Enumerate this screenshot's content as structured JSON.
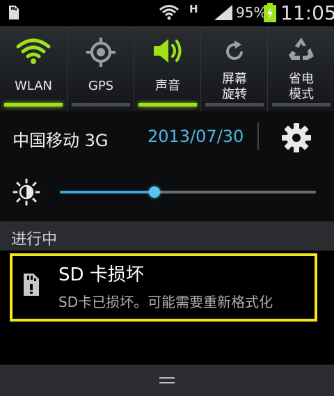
{
  "status_bar": {
    "network_type": "H",
    "battery_percent": "95%",
    "time": "11:05"
  },
  "quick_toggles": [
    {
      "label": "WLAN",
      "state": "on"
    },
    {
      "label": "GPS",
      "state": "off"
    },
    {
      "label": "声音",
      "state": "on"
    },
    {
      "label": "屏幕\n旋转",
      "state": "off"
    },
    {
      "label": "省电\n模式",
      "state": "off"
    }
  ],
  "info_row": {
    "carrier": "中国移动 3G",
    "date": "2013/07/30"
  },
  "brightness": {
    "level": 0.37
  },
  "section": {
    "title": "进行中"
  },
  "notification": {
    "title": "SD 卡损坏",
    "text": "SD卡已损坏。可能需要重新格式化"
  },
  "colors": {
    "accent_green": "#9ee31a",
    "accent_blue": "#4fb6e6",
    "highlight_yellow": "#f5e51c"
  }
}
